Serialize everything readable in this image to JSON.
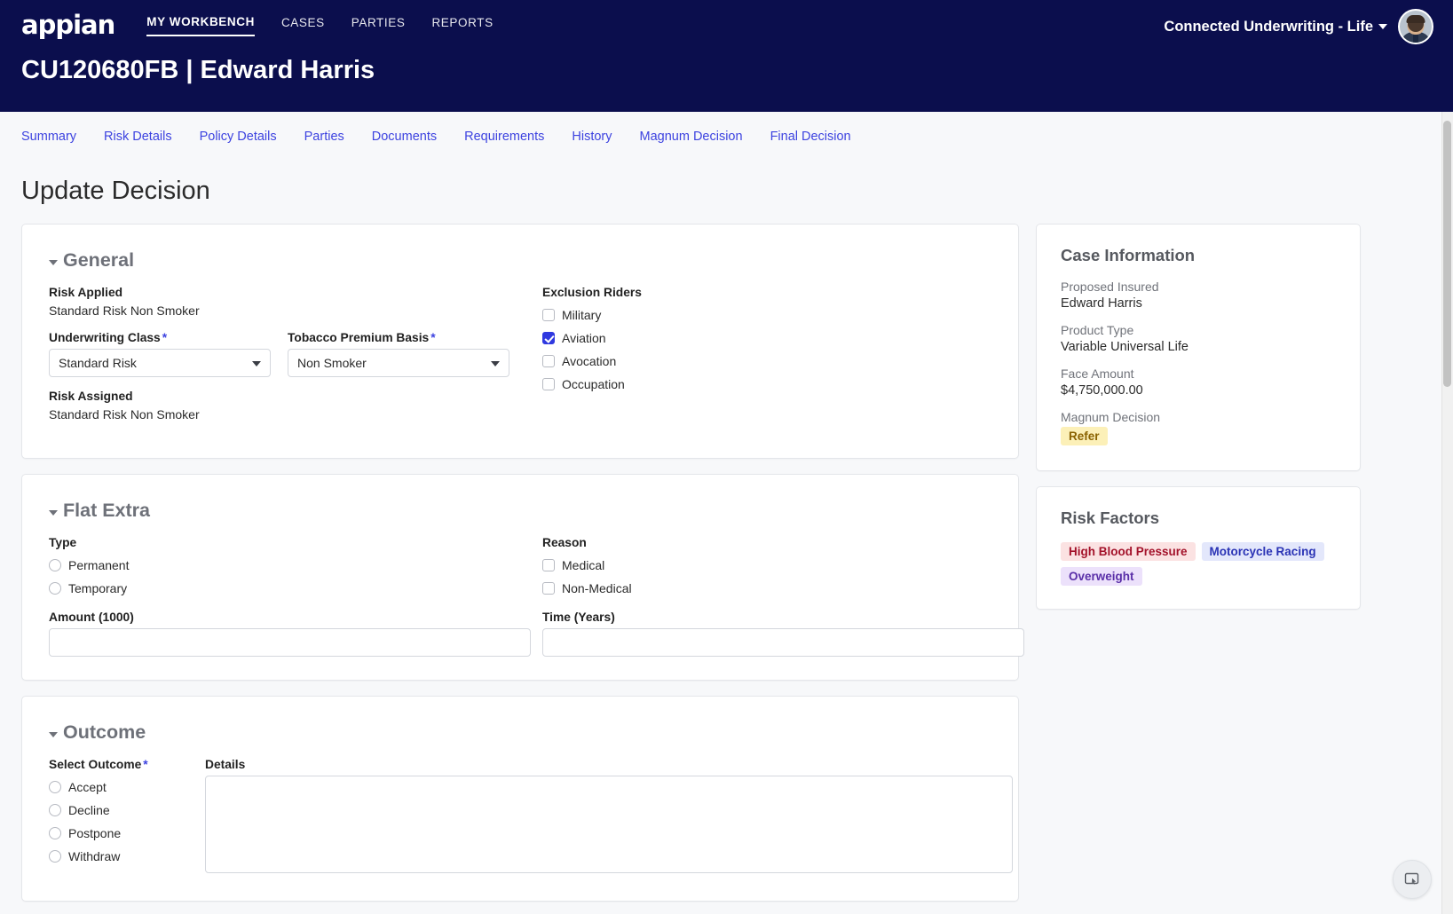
{
  "topnav": {
    "brand": "appian",
    "links": [
      {
        "label": "MY WORKBENCH",
        "active": true
      },
      {
        "label": "CASES",
        "active": false
      },
      {
        "label": "PARTIES",
        "active": false
      },
      {
        "label": "REPORTS",
        "active": false
      }
    ],
    "tenant": "Connected Underwriting - Life",
    "case_title": "CU120680FB | Edward Harris"
  },
  "tabs": [
    {
      "label": "Summary"
    },
    {
      "label": "Risk Details"
    },
    {
      "label": "Policy Details"
    },
    {
      "label": "Parties"
    },
    {
      "label": "Documents"
    },
    {
      "label": "Requirements"
    },
    {
      "label": "History"
    },
    {
      "label": "Magnum Decision"
    },
    {
      "label": "Final Decision"
    }
  ],
  "page_title": "Update Decision",
  "general": {
    "section_title": "General",
    "risk_applied_label": "Risk Applied",
    "risk_applied_value": "Standard Risk Non Smoker",
    "underwriting_class_label": "Underwriting Class",
    "underwriting_class_value": "Standard Risk",
    "tobacco_label": "Tobacco Premium Basis",
    "tobacco_value": "Non Smoker",
    "risk_assigned_label": "Risk Assigned",
    "risk_assigned_value": "Standard Risk Non Smoker",
    "exclusion_label": "Exclusion Riders",
    "exclusions": [
      {
        "label": "Military",
        "checked": false
      },
      {
        "label": "Aviation",
        "checked": true
      },
      {
        "label": "Avocation",
        "checked": false
      },
      {
        "label": "Occupation",
        "checked": false
      }
    ]
  },
  "flat_extra": {
    "section_title": "Flat Extra",
    "type_label": "Type",
    "types": [
      {
        "label": "Permanent",
        "selected": false
      },
      {
        "label": "Temporary",
        "selected": false
      }
    ],
    "amount_label": "Amount (1000)",
    "amount_value": "",
    "amount_placeholder": "",
    "reason_label": "Reason",
    "reasons": [
      {
        "label": "Medical",
        "checked": false
      },
      {
        "label": "Non-Medical",
        "checked": false
      }
    ],
    "time_label": "Time (Years)",
    "time_value": "",
    "time_placeholder": ""
  },
  "outcome": {
    "section_title": "Outcome",
    "select_outcome_label": "Select Outcome",
    "options": [
      {
        "label": "Accept",
        "selected": false
      },
      {
        "label": "Decline",
        "selected": false
      },
      {
        "label": "Postpone",
        "selected": false
      },
      {
        "label": "Withdraw",
        "selected": false
      }
    ],
    "details_label": "Details",
    "details_value": "",
    "details_placeholder": ""
  },
  "case_information": {
    "title": "Case Information",
    "fields": [
      {
        "key": "Proposed Insured",
        "value": "Edward Harris"
      },
      {
        "key": "Product Type",
        "value": "Variable Universal Life"
      },
      {
        "key": "Face Amount",
        "value": "$4,750,000.00"
      }
    ],
    "magnum_decision_label": "Magnum Decision",
    "magnum_decision_value": "Refer",
    "magnum_decision_bg": "#fcf0b8",
    "magnum_decision_fg": "#8a6200"
  },
  "risk_factors": {
    "title": "Risk Factors",
    "tags": [
      {
        "label": "High Blood Pressure",
        "bg": "#fbe2e2",
        "fg": "#a3122a"
      },
      {
        "label": "Motorcycle Racing",
        "bg": "#e3e7fb",
        "fg": "#2a33b5"
      },
      {
        "label": "Overweight",
        "bg": "#ece1fb",
        "fg": "#5a2fa8"
      }
    ]
  },
  "icons": {
    "fab": "screen-capture-icon",
    "chevron": "chevron-down-icon"
  },
  "colors": {
    "navy": "#0b0e4d",
    "accent_blue": "#3d43e0",
    "checkbox_blue": "#2f39e0",
    "page_bg": "#f7f8fa"
  }
}
